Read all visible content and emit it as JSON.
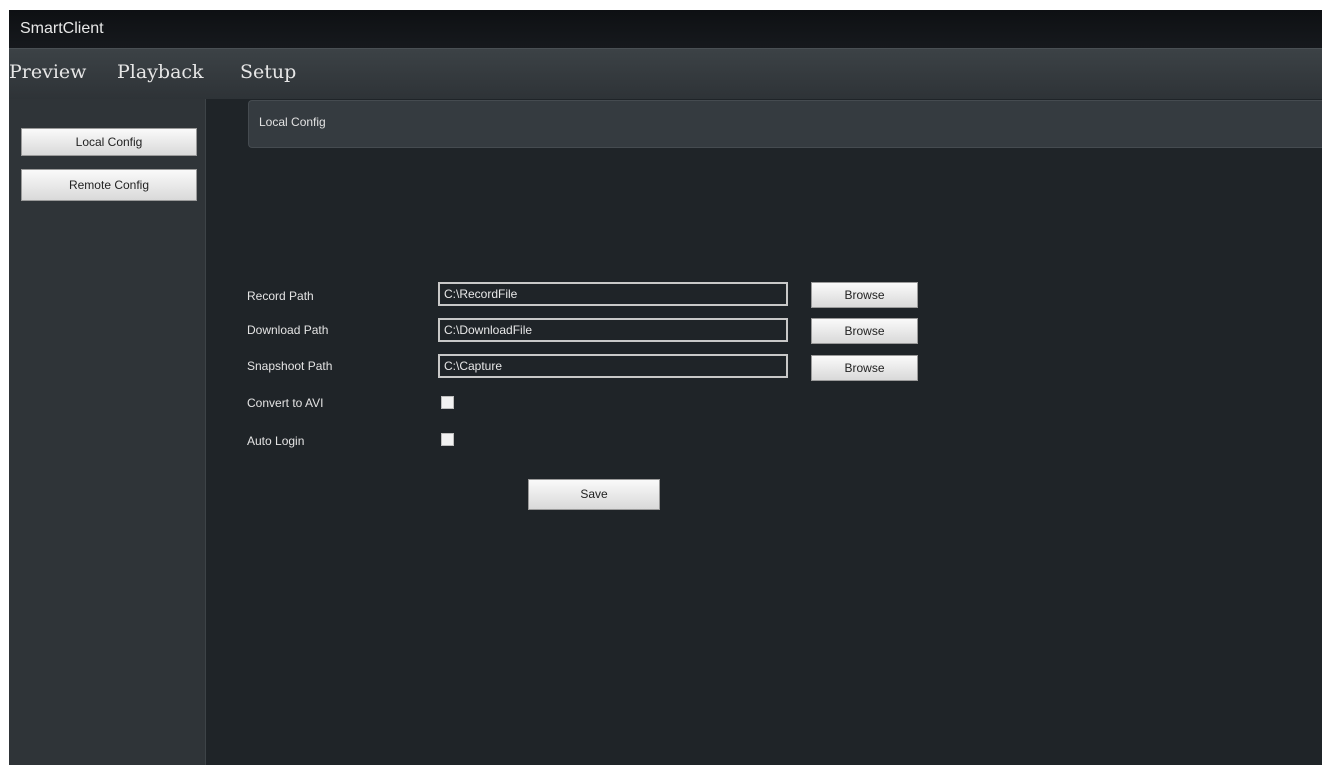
{
  "window": {
    "title": "SmartClient"
  },
  "menu": {
    "preview": "Preview",
    "playback": "Playback",
    "setup": "Setup"
  },
  "sidebar": {
    "local_config": "Local Config",
    "remote_config": "Remote Config"
  },
  "panel": {
    "title": "Local Config"
  },
  "form": {
    "record_path": {
      "label": "Record Path",
      "value": "C:\\RecordFile",
      "browse": "Browse"
    },
    "download_path": {
      "label": "Download Path",
      "value": "C:\\DownloadFile",
      "browse": "Browse"
    },
    "snapshoot_path": {
      "label": "Snapshoot Path",
      "value": "C:\\Capture",
      "browse": "Browse"
    },
    "convert_avi": {
      "label": "Convert to AVI",
      "checked": false
    },
    "auto_login": {
      "label": "Auto Login",
      "checked": false
    },
    "save": "Save"
  }
}
